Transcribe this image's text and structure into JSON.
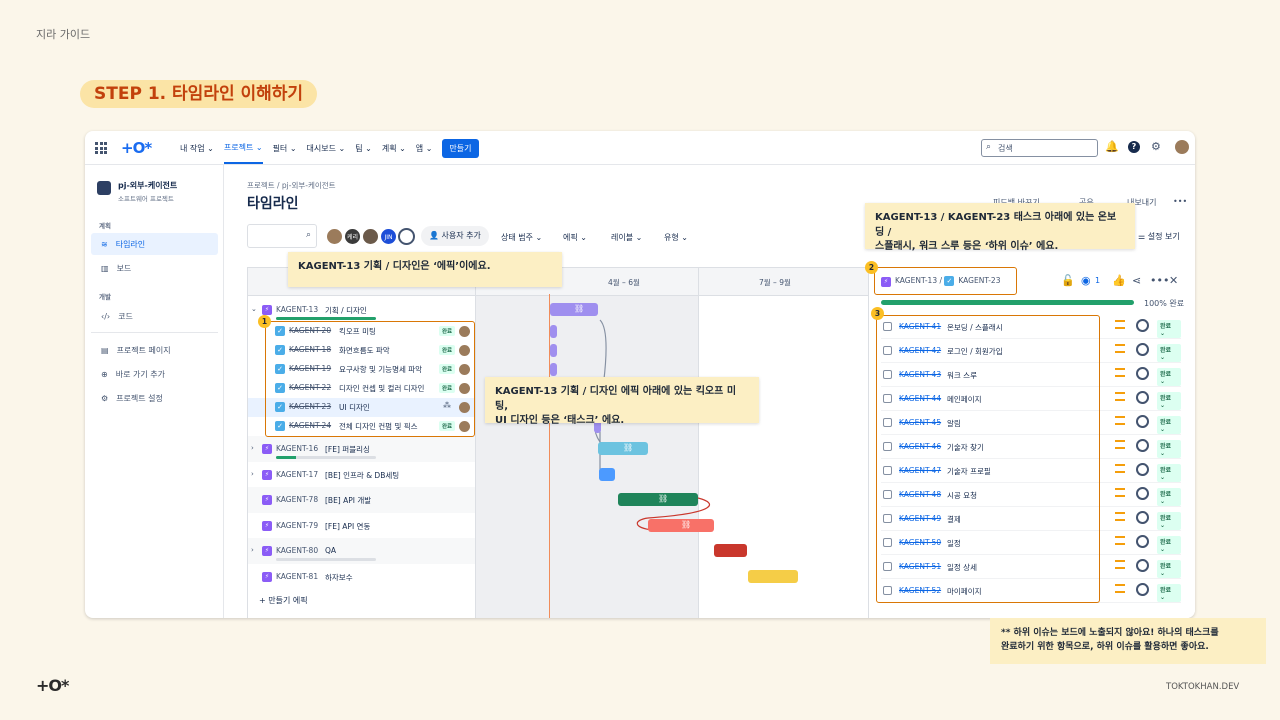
{
  "doc": {
    "header": "지라 가이드",
    "step_title": "STEP 1. 타임라인 이해하기",
    "footer_logo": "+O*",
    "footer_url": "TOKTOKHAN.DEV"
  },
  "topbar": {
    "logo": "+O*",
    "nav": [
      "내 작업 ⌄",
      "프로젝트 ⌄",
      "필터 ⌄",
      "대시보드 ⌄",
      "팀 ⌄",
      "계획 ⌄",
      "앱 ⌄"
    ],
    "create": "만들기",
    "search_placeholder": "검색"
  },
  "sidebar": {
    "project_name": "pj-외부-케이전트",
    "project_type": "소프트웨어 프로젝트",
    "section_plan": "계획",
    "timeline": "타임라인",
    "board": "보드",
    "section_dev": "개발",
    "code": "코드",
    "project_page": "프로젝트 페이지",
    "shortcut": "바로 가기 추가",
    "settings": "프로젝트 설정"
  },
  "page": {
    "breadcrumb": "프로젝트  /  pj-외부-케이전트",
    "title": "타임라인",
    "actions": [
      "피드백 바꾸기",
      "공유",
      "내보내기",
      "•••"
    ]
  },
  "toolbar": {
    "add_user": "사용자 추가",
    "filters": [
      "상태 범주 ⌄",
      "에픽 ⌄",
      "레이블 ⌄",
      "유형 ⌄"
    ],
    "settings": "설정 보기",
    "avatars": [
      "",
      "케리",
      "",
      "JIN",
      ""
    ]
  },
  "timeline": {
    "months": [
      "4월 – 6월",
      "7월 – 9월"
    ],
    "rows": [
      {
        "key": "KAGENT-13",
        "title": "기획 / 디자인",
        "kind": "epic",
        "chev": "⌄",
        "done": false
      },
      {
        "key": "KAGENT-20",
        "title": "킥오프 미팅",
        "kind": "task",
        "done": true,
        "status": "완료"
      },
      {
        "key": "KAGENT-18",
        "title": "화면흐름도 파악",
        "kind": "task",
        "done": true,
        "status": "완료"
      },
      {
        "key": "KAGENT-19",
        "title": "요구사항 및 기능명세 파악",
        "kind": "task",
        "done": true,
        "status": "완료"
      },
      {
        "key": "KAGENT-22",
        "title": "디자인 컨셉 및 컬러 디자인",
        "kind": "task",
        "done": true,
        "status": "완료"
      },
      {
        "key": "KAGENT-23",
        "title": "UI 디자인",
        "kind": "task",
        "done": true,
        "status": ""
      },
      {
        "key": "KAGENT-24",
        "title": "전체 디자인 컨펌 및 픽스",
        "kind": "task",
        "done": true,
        "status": "완료"
      },
      {
        "key": "KAGENT-16",
        "title": "[FE] 퍼블리싱",
        "kind": "epic",
        "chev": "›",
        "done": false
      },
      {
        "key": "KAGENT-17",
        "title": "[BE] 인프라 & DB세팅",
        "kind": "epic",
        "chev": "›",
        "done": false
      },
      {
        "key": "KAGENT-78",
        "title": "[BE] API 개발",
        "kind": "epic",
        "chev": "",
        "done": false
      },
      {
        "key": "KAGENT-79",
        "title": "[FE] API 연동",
        "kind": "epic",
        "chev": "",
        "done": false
      },
      {
        "key": "KAGENT-80",
        "title": "QA",
        "kind": "epic",
        "chev": "›",
        "done": false
      },
      {
        "key": "KAGENT-81",
        "title": "하자보수",
        "kind": "epic",
        "chev": "",
        "done": false
      }
    ],
    "create_epic": "+ 만들기 에픽",
    "colors": {
      "purple": "#9f8fef",
      "blue": "#6cc3e0",
      "green": "#1f845a",
      "salmon": "#f87168",
      "red": "#c9372c",
      "yellow": "#f5cd47"
    }
  },
  "detail": {
    "crumb1": "KAGENT-13",
    "crumb2": "KAGENT-23",
    "watchers": "1",
    "progress_pct": 100,
    "progress_label": "100% 완료",
    "subtasks": [
      {
        "key": "KAGENT-41",
        "title": "온보딩 / 스플래시",
        "status": "완료 ⌄"
      },
      {
        "key": "KAGENT-42",
        "title": "로그인 / 회원가입",
        "status": "완료 ⌄"
      },
      {
        "key": "KAGENT-43",
        "title": "워크 스루",
        "status": "완료 ⌄"
      },
      {
        "key": "KAGENT-44",
        "title": "메인페이지",
        "status": "완료 ⌄"
      },
      {
        "key": "KAGENT-45",
        "title": "알림",
        "status": "완료 ⌄"
      },
      {
        "key": "KAGENT-46",
        "title": "기술자 찾기",
        "status": "완료 ⌄"
      },
      {
        "key": "KAGENT-47",
        "title": "기술자 프로필",
        "status": "완료 ⌄"
      },
      {
        "key": "KAGENT-48",
        "title": "시공 요청",
        "status": "완료 ⌄"
      },
      {
        "key": "KAGENT-49",
        "title": "결제",
        "status": "완료 ⌄"
      },
      {
        "key": "KAGENT-50",
        "title": "일정",
        "status": "완료 ⌄"
      },
      {
        "key": "KAGENT-51",
        "title": "일정 상세",
        "status": "완료 ⌄"
      },
      {
        "key": "KAGENT-52",
        "title": "마이페이지",
        "status": "완료 ⌄"
      }
    ]
  },
  "callouts": {
    "epic": "KAGENT-13 기획 / 디자인은 ‘에픽’이에요.",
    "task": "KAGENT-13 기획 / 디자인 에픽 아래에 있는 킥오프 미팅,\nUI 디자인 등은 ‘태스크’ 에요.",
    "subtask": "KAGENT-13 / KAGENT-23 태스크 아래에 있는 온보딩 /\n스플래시, 워크 스루 등은 ‘하위 이슈’ 에요.",
    "note": "** 하위 이슈는 보드에 노출되지 않아요! 하나의 태스크를\n완료하기 위한 항목으로, 하위 이슈를 활용하면 좋아요.",
    "badge1": "1",
    "badge2": "2",
    "badge3": "3"
  }
}
